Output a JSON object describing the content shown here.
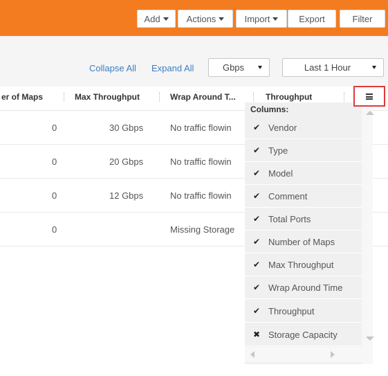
{
  "toolbar": {
    "add_label": "Add",
    "actions_label": "Actions",
    "import_label": "Import",
    "export_label": "Export",
    "filter_label": "Filter",
    "bar_color": "#f47c20"
  },
  "controls": {
    "collapse_all": "Collapse All",
    "expand_all": "Expand All",
    "unit_select": "Gbps",
    "time_select": "Last 1 Hour"
  },
  "table": {
    "columns": [
      "er of Maps",
      "Max Throughput",
      "Wrap Around T...",
      "Throughput"
    ],
    "rows": [
      {
        "maps": "0",
        "max_throughput": "30 Gbps",
        "wrap": "No traffic flowin"
      },
      {
        "maps": "0",
        "max_throughput": "20 Gbps",
        "wrap": "No traffic flowin"
      },
      {
        "maps": "0",
        "max_throughput": "12 Gbps",
        "wrap": "No traffic flowin"
      },
      {
        "maps": "0",
        "max_throughput": "",
        "wrap": "Missing Storage"
      }
    ]
  },
  "column_menu": {
    "title": "Columns:",
    "items": [
      {
        "label": "Vendor",
        "mark": "✔"
      },
      {
        "label": "Type",
        "mark": "✔"
      },
      {
        "label": "Model",
        "mark": "✔"
      },
      {
        "label": "Comment",
        "mark": "✔"
      },
      {
        "label": "Total Ports",
        "mark": "✔"
      },
      {
        "label": "Number of Maps",
        "mark": "✔"
      },
      {
        "label": "Max Throughput",
        "mark": "✔"
      },
      {
        "label": "Wrap Around Time",
        "mark": "✔"
      },
      {
        "label": "Throughput",
        "mark": "✔"
      },
      {
        "label": "Storage Capacity",
        "mark": "✖"
      }
    ],
    "highlight_color": "#e03a3a"
  }
}
